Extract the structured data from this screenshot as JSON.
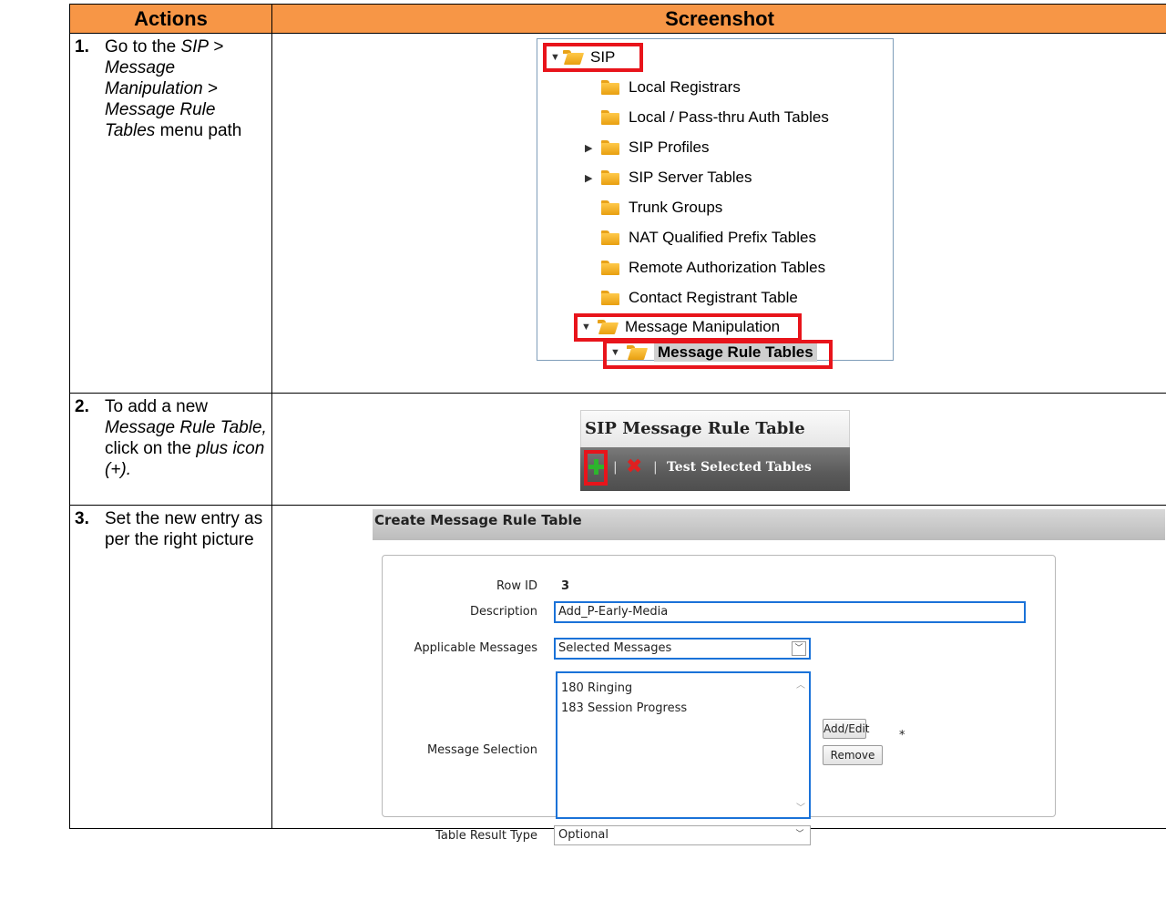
{
  "headers": {
    "actions": "Actions",
    "screenshot": "Screenshot"
  },
  "steps": [
    {
      "num": "1.",
      "text": [
        "Go to the ",
        "SIP",
        " > ",
        "Message Manipulation",
        " > ",
        "Message Rule Tables",
        " menu path"
      ]
    },
    {
      "num": "2.",
      "text": [
        "To add a new ",
        "Message Rule Table,",
        " click on the ",
        "plus icon (+)."
      ]
    },
    {
      "num": "3.",
      "text": "Set the new entry as per the right picture"
    }
  ],
  "tree": {
    "root": "SIP",
    "items": [
      "Local Registrars",
      "Local / Pass-thru Auth Tables",
      "SIP Profiles",
      "SIP Server Tables",
      "Trunk Groups",
      "NAT Qualified Prefix Tables",
      "Remote Authorization Tables",
      "Contact Registrant Table",
      "Message Manipulation",
      "Message Rule Tables"
    ]
  },
  "rule_table_panel": {
    "title": "SIP Message Rule Table",
    "separator": "|",
    "test_label": "Test Selected Tables"
  },
  "create_form": {
    "title": "Create Message Rule Table",
    "row_id_label": "Row ID",
    "row_id_value": "3",
    "description_label": "Description",
    "description_value": "Add_P-Early-Media",
    "applicable_label": "Applicable Messages",
    "applicable_value": "Selected Messages",
    "selection_label": "Message Selection",
    "selection_items": [
      "180 Ringing",
      "183 Session Progress"
    ],
    "add_edit_label": "Add/Edit",
    "remove_label": "Remove",
    "required_mark": "*",
    "result_type_label": "Table Result Type",
    "result_type_value": "Optional"
  },
  "colors": {
    "header_bg": "#f79646",
    "highlight_red": "#e8141b",
    "focus_blue": "#1a72d8"
  }
}
